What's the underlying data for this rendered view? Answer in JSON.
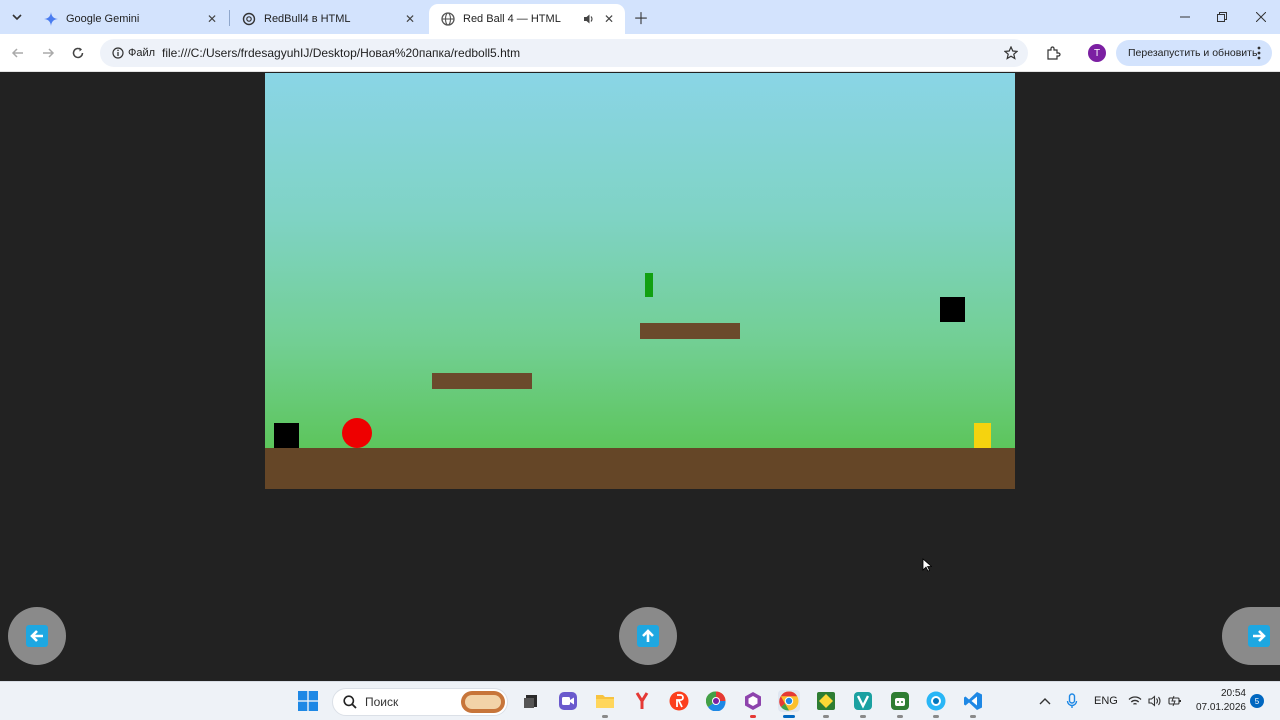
{
  "browser": {
    "tabs": [
      {
        "title": "Google Gemini",
        "icon": "gemini-icon",
        "active": false
      },
      {
        "title": "RedBull4 в HTML",
        "icon": "chatgpt-icon",
        "active": false
      },
      {
        "title": "Red Ball 4 — HTML",
        "icon": "globe-icon",
        "active": true,
        "audio": true
      }
    ],
    "file_label": "Файл",
    "url": "file:///C:/Users/frdesagyuhIJ/Desktop/Новая%20папка/redboll5.htm",
    "profile_initial": "T",
    "relaunch_label": "Перезапустить и обновить",
    "colors": {
      "tabstrip": "#d3e3fd",
      "profile": "#7b1fa2"
    }
  },
  "game": {
    "colors": {
      "sky_top": "#8ad5e6",
      "sky_bottom": "#5cc55a",
      "ground": "#654627",
      "ball": "#ee0000",
      "goal": "#f5d30f",
      "pickup": "#11a011",
      "crate": "#000000"
    },
    "elements": [
      "player-ball",
      "start-crate",
      "floating-crate",
      "platform-low",
      "platform-high",
      "green-pickup",
      "yellow-goal-flag",
      "ground"
    ]
  },
  "controls": [
    {
      "name": "left-control",
      "icon": "arrow-left-icon",
      "color": "#1ea7e1"
    },
    {
      "name": "jump-control",
      "icon": "arrow-up-icon",
      "color": "#1ea7e1"
    },
    {
      "name": "right-control",
      "icon": "arrow-right-icon",
      "color": "#1ea7e1"
    }
  ],
  "taskbar": {
    "search_label": "Поиск",
    "language": "ENG",
    "time": "20:54",
    "date": "07.01.2026",
    "notification_count": "5",
    "apps": [
      "start-icon",
      "search-icon",
      "widgets-icon",
      "task-view-icon",
      "zoom-icon",
      "file-explorer-icon",
      "yandex-icon",
      "yandex-browser-icon",
      "chromium-icon",
      "visual-studio-icon",
      "chrome-icon",
      "app-icon",
      "vivaldi-icon",
      "android-studio-icon",
      "app-icon",
      "vscode-icon"
    ]
  }
}
